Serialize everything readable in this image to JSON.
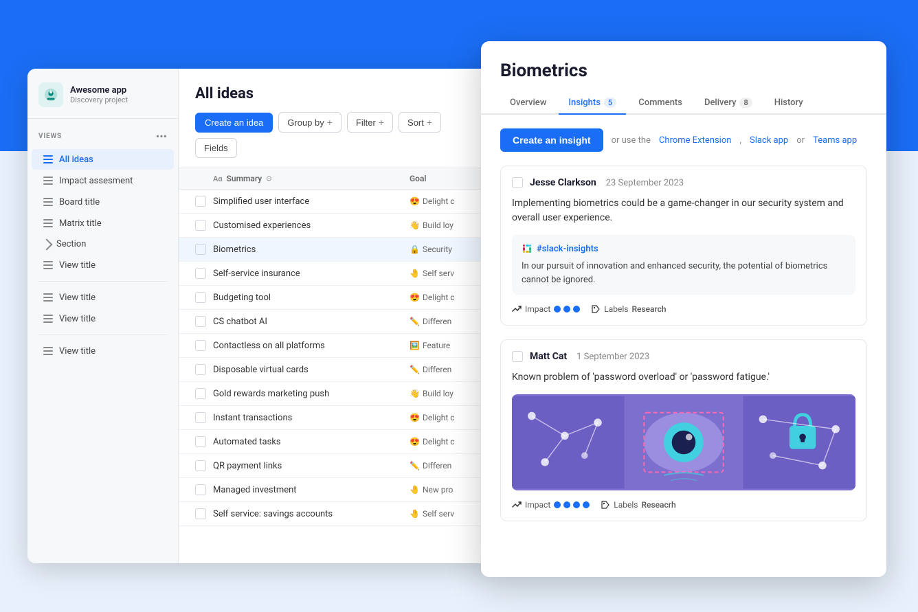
{
  "app": {
    "name": "Awesome app",
    "subtitle": "Discovery project"
  },
  "sidebar": {
    "views_label": "VIEWS",
    "items": [
      {
        "id": "all-ideas",
        "label": "All ideas",
        "active": true
      },
      {
        "id": "impact-assessment",
        "label": "Impact assesment",
        "active": false
      },
      {
        "id": "board-title",
        "label": "Board title",
        "active": false
      },
      {
        "id": "matrix-title",
        "label": "Matrix title",
        "active": false
      },
      {
        "id": "section",
        "label": "Section",
        "active": false,
        "type": "section"
      },
      {
        "id": "view-title-1",
        "label": "View title",
        "active": false
      },
      {
        "id": "view-title-2",
        "label": "View title",
        "active": false
      },
      {
        "id": "view-title-3",
        "label": "View title",
        "active": false
      },
      {
        "id": "view-title-4",
        "label": "View title",
        "active": false
      }
    ]
  },
  "main": {
    "title": "All ideas",
    "toolbar": {
      "create_idea": "Create an idea",
      "group_by": "Group by",
      "filter": "Filter",
      "sort": "Sort",
      "fields": "Fields"
    },
    "table": {
      "columns": [
        {
          "id": "summary",
          "label": "Summary"
        },
        {
          "id": "goal",
          "label": "Goal"
        }
      ],
      "rows": [
        {
          "id": 1,
          "name": "Simplified user interface",
          "goal_emoji": "😍",
          "goal_text": "Delight c"
        },
        {
          "id": 2,
          "name": "Customised experiences",
          "goal_emoji": "👋",
          "goal_text": "Build loy"
        },
        {
          "id": 3,
          "name": "Biometrics",
          "goal_emoji": "🔒",
          "goal_text": "Security",
          "selected": true
        },
        {
          "id": 4,
          "name": "Self-service insurance",
          "goal_emoji": "🤚",
          "goal_text": "Self serv"
        },
        {
          "id": 5,
          "name": "Budgeting tool",
          "goal_emoji": "😍",
          "goal_text": "Delight c"
        },
        {
          "id": 6,
          "name": "CS chatbot AI",
          "goal_emoji": "✏️",
          "goal_text": "Differen"
        },
        {
          "id": 7,
          "name": "Contactless on all platforms",
          "goal_emoji": "🖼️",
          "goal_text": "Feature"
        },
        {
          "id": 8,
          "name": "Disposable virtual cards",
          "goal_emoji": "✏️",
          "goal_text": "Differen"
        },
        {
          "id": 9,
          "name": "Gold rewards marketing push",
          "goal_emoji": "👋",
          "goal_text": "Build loy"
        },
        {
          "id": 10,
          "name": "Instant transactions",
          "goal_emoji": "😍",
          "goal_text": "Delight c"
        },
        {
          "id": 11,
          "name": "Automated tasks",
          "goal_emoji": "😍",
          "goal_text": "Delight c"
        },
        {
          "id": 12,
          "name": "QR payment links",
          "goal_emoji": "✏️",
          "goal_text": "Differen"
        },
        {
          "id": 13,
          "name": "Managed investment",
          "goal_emoji": "🤚",
          "goal_text": "New pro"
        },
        {
          "id": 14,
          "name": "Self service: savings accounts",
          "goal_emoji": "🤚",
          "goal_text": "Self serv"
        }
      ]
    }
  },
  "detail": {
    "title": "Biometrics",
    "tabs": [
      {
        "id": "overview",
        "label": "Overview",
        "active": false
      },
      {
        "id": "insights",
        "label": "Insights",
        "badge": "5",
        "active": true
      },
      {
        "id": "comments",
        "label": "Comments",
        "active": false
      },
      {
        "id": "delivery",
        "label": "Delivery",
        "badge": "8",
        "active": false
      },
      {
        "id": "history",
        "label": "History",
        "active": false
      }
    ],
    "create_insight_btn": "Create an insight",
    "or_text": "or use the",
    "chrome_ext": "Chrome Extension",
    "comma1": ",",
    "slack_app": "Slack app",
    "or2": "or",
    "teams_app": "Teams app",
    "insights": [
      {
        "id": 1,
        "author": "Jesse Clarkson",
        "date": "23 September 2023",
        "text": "Implementing biometrics could be a game-changer in our security system and overall user experience.",
        "slack_channel": "#slack-insights",
        "slack_text": "In our pursuit of innovation and enhanced security, the potential of biometrics cannot be ignored.",
        "impact_dots": 3,
        "impact_total": 3,
        "labels_label": "Labels",
        "labels_value": "Research"
      },
      {
        "id": 2,
        "author": "Matt Cat",
        "date": "1 September 2023",
        "text": "Known problem of 'password overload' or 'password fatigue.'",
        "has_image": true,
        "impact_dots": 4,
        "impact_total": 4,
        "labels_label": "Labels",
        "labels_value": "Reseacrh"
      }
    ]
  },
  "icons": {
    "list": "☰",
    "more": "•••",
    "plus": "+",
    "chevron_right": "›",
    "trend": "↗",
    "tag": "🏷"
  }
}
